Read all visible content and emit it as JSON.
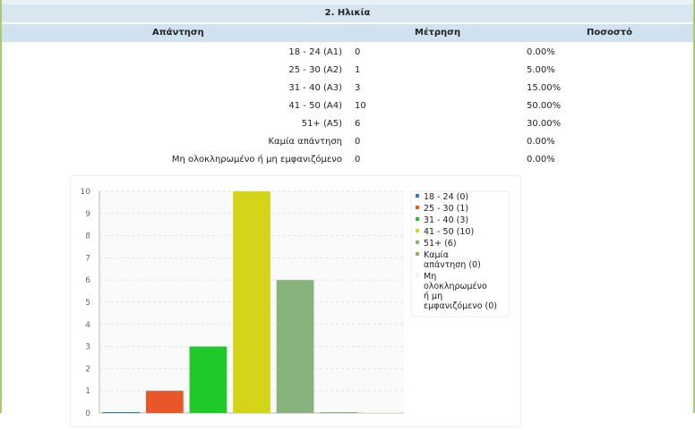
{
  "question_title": "2. Ηλικία",
  "headers": {
    "answer": "Απάντηση",
    "count": "Μέτρηση",
    "percent": "Ποσοστό"
  },
  "rows": [
    {
      "label": "18 - 24 (A1)",
      "count": "0",
      "percent": "0.00%"
    },
    {
      "label": "25 - 30 (A2)",
      "count": "1",
      "percent": "5.00%"
    },
    {
      "label": "31 - 40 (A3)",
      "count": "3",
      "percent": "15.00%"
    },
    {
      "label": "41 - 50 (A4)",
      "count": "10",
      "percent": "50.00%"
    },
    {
      "label": "51+ (A5)",
      "count": "6",
      "percent": "30.00%"
    },
    {
      "label": "Καμία απάντηση",
      "count": "0",
      "percent": "0.00%"
    },
    {
      "label": "Μη ολοκληρωμένο ή μη εμφανιζόμενο",
      "count": "0",
      "percent": "0.00%"
    }
  ],
  "chart_data": {
    "type": "bar",
    "categories": [
      "18 - 24",
      "25 - 30",
      "31 - 40",
      "41 - 50",
      "51+",
      "Καμία απάντηση",
      "Μη ολοκληρωμένο ή μη εμφανιζόμενο"
    ],
    "values": [
      0,
      1,
      3,
      10,
      6,
      0,
      0
    ],
    "colors": [
      "#2b7cd3",
      "#e8562a",
      "#1fc92a",
      "#d4d418",
      "#86b47c",
      "#8fb56b",
      "#f4f6dc"
    ],
    "legend": [
      [
        "18 - 24 (0)"
      ],
      [
        "25 - 30 (1)"
      ],
      [
        "31 - 40 (3)"
      ],
      [
        "41 - 50 (10)"
      ],
      [
        "51+ (6)"
      ],
      [
        "Καμία",
        "απάντηση (0)"
      ],
      [
        "Μη",
        "ολοκληρωμένο",
        "ή μη",
        "εμφανιζόμενο (0)"
      ]
    ],
    "yticks": [
      0,
      1,
      2,
      3,
      4,
      5,
      6,
      7,
      8,
      9,
      10
    ],
    "ylim": [
      0,
      10
    ],
    "grid": true,
    "legend_position": "right"
  }
}
